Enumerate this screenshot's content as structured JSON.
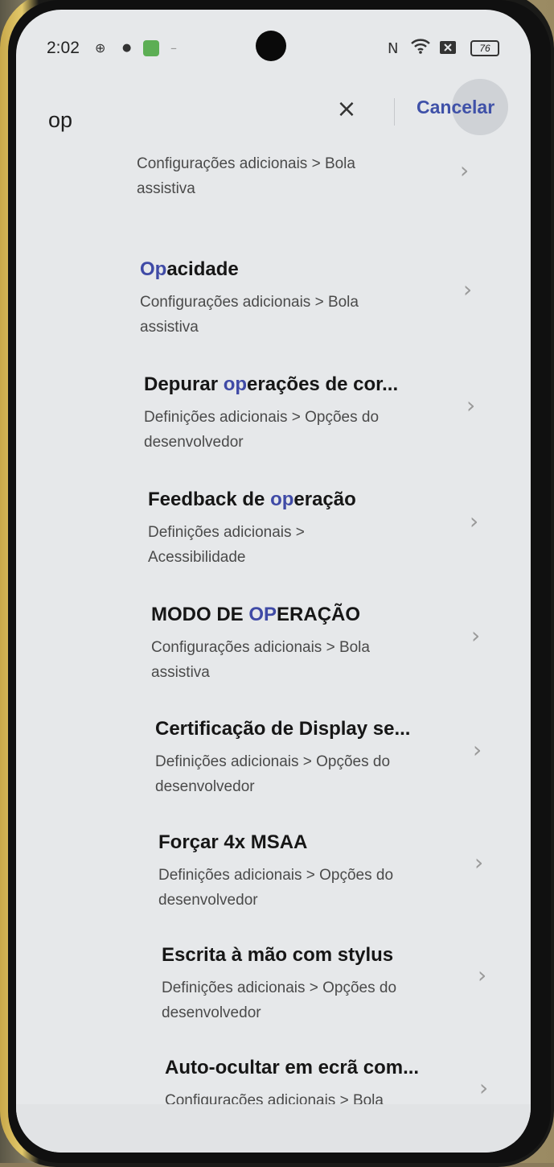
{
  "status_bar": {
    "time": "2:02",
    "icons": [
      "location-icon",
      "bug-icon",
      "app-icon",
      "nfc-icon",
      "wifi-icon",
      "sim-icon"
    ],
    "battery": "76"
  },
  "search": {
    "query": "op",
    "cancel_label": "Cancelar"
  },
  "results": [
    {
      "title_pre": "",
      "title_hl": "",
      "title_post": "",
      "path_line1": "Configurações adicionais > Bola",
      "path_line2": "assistiva"
    },
    {
      "title_pre": "",
      "title_hl": "Op",
      "title_post": "acidade",
      "path_line1": "Configurações adicionais > Bola",
      "path_line2": "assistiva"
    },
    {
      "title_pre": "Depurar ",
      "title_hl": "op",
      "title_post": "erações de cor...",
      "path_line1": "Definições adicionais > Opções do",
      "path_line2": "desenvolvedor"
    },
    {
      "title_pre": "Feedback de ",
      "title_hl": "op",
      "title_post": "eração",
      "path_line1": "Definições adicionais >",
      "path_line2": "Acessibilidade"
    },
    {
      "title_pre": "MODO DE ",
      "title_hl": "OP",
      "title_post": "ERAÇÃO",
      "path_line1": "Configurações adicionais > Bola",
      "path_line2": "assistiva"
    },
    {
      "title_pre": "Certificação de Display se...",
      "title_hl": "",
      "title_post": "",
      "path_line1": "Definições adicionais > Opções do",
      "path_line2": "desenvolvedor"
    },
    {
      "title_pre": "Forçar 4x MSAA",
      "title_hl": "",
      "title_post": "",
      "path_line1": "Definições adicionais > Opções do",
      "path_line2": "desenvolvedor"
    },
    {
      "title_pre": "Escrita à mão com stylus",
      "title_hl": "",
      "title_post": "",
      "path_line1": "Definições adicionais > Opções do",
      "path_line2": "desenvolvedor"
    },
    {
      "title_pre": "Auto-ocultar em ecrã com...",
      "title_hl": "",
      "title_post": "",
      "path_line1": "Configurações adicionais > Bola",
      "path_line2": ""
    }
  ],
  "colors": {
    "highlight": "#3f4aa6",
    "cancel": "#3f51a8",
    "screen_bg": "#e6e8ea"
  }
}
